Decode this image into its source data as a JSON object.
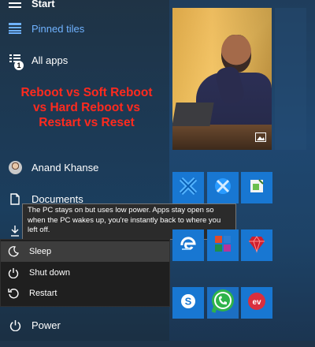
{
  "menu": {
    "top_partial_label": "Start",
    "pinned_tiles_label": "Pinned tiles",
    "all_apps_label": "All apps",
    "all_apps_badge": "1",
    "user_name": "Anand Khanse",
    "documents_label": "Documents",
    "power_label": "Power"
  },
  "headline": {
    "text": "Reboot vs Soft Reboot vs Hard Reboot vs Restart vs Reset",
    "color": "#ff2a1e"
  },
  "tooltip": {
    "text": "The PC stays on but uses low power. Apps stay open so when the PC wakes up, you're instantly back to where you left off."
  },
  "power_menu": {
    "sleep_label": "Sleep",
    "shutdown_label": "Shut down",
    "restart_label": "Restart"
  },
  "tiles": {
    "icons": [
      "photo-icon",
      "windows-tile-icon",
      "windows-store-icon",
      "sticky-notes-icon",
      "edge-icon",
      "office-icon",
      "ruby-app-icon",
      "skype-icon",
      "whatsapp-icon",
      "expressvpn-icon"
    ]
  },
  "colors": {
    "accent": "#1877d2",
    "pinned_text": "#6fb2ff",
    "tooltip_bg": "#2b2b2b"
  }
}
